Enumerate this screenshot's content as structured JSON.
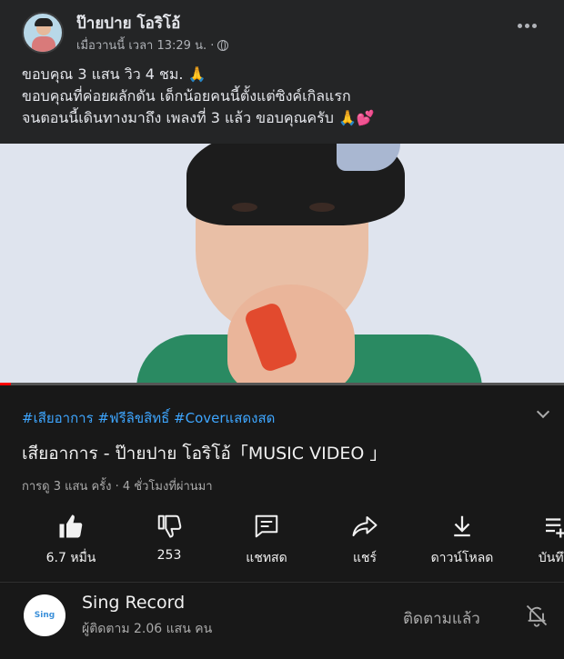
{
  "post": {
    "author": "ป๊ายปาย โอริโอ้",
    "timestamp": "เมื่อวานนี้ เวลา 13:29 น. ·",
    "privacy_icon": "globe-icon",
    "lines": [
      "ขอบคุณ 3 แสน วิว 4 ชม. 🙏",
      "ขอบคุณที่ค่อยผลักดัน เด็กน้อยคนนี้ตั้งแต่ซิงค์เกิลแรก",
      "จนตอนนี้เดินทางมาถึง เพลงที่ 3 แล้ว ขอบคุณครับ 🙏💕"
    ]
  },
  "video": {
    "tags": "#เสียอาการ #ฟรีลิขสิทธิ์ #Coverแสดงสด",
    "title": "เสียอาการ - ป๊ายปาย โอริโอ้「MUSIC VIDEO 」",
    "stats": "การดู 3 แสน ครั้ง · 4 ชั่วโมงที่ผ่านมา",
    "progress": 0.02
  },
  "actions": [
    {
      "icon": "thumbs-up-icon",
      "label": "6.7 หมื่น"
    },
    {
      "icon": "thumbs-down-icon",
      "label": "253"
    },
    {
      "icon": "live-chat-icon",
      "label": "แชทสด"
    },
    {
      "icon": "share-icon",
      "label": "แชร์"
    },
    {
      "icon": "download-icon",
      "label": "ดาวน์โหลด"
    },
    {
      "icon": "save-icon",
      "label": "บันทึก"
    }
  ],
  "channel": {
    "logo_text": "Sing",
    "name": "Sing Record",
    "subscribers": "ผู้ติดตาม 2.06 แสน คน",
    "follow_label": "ติดตามแล้ว",
    "bell_icon": "bell-off-icon"
  },
  "colors": {
    "background": "#242526",
    "card": "#181818",
    "link": "#3ea6ff",
    "progress": "#ff0000"
  }
}
